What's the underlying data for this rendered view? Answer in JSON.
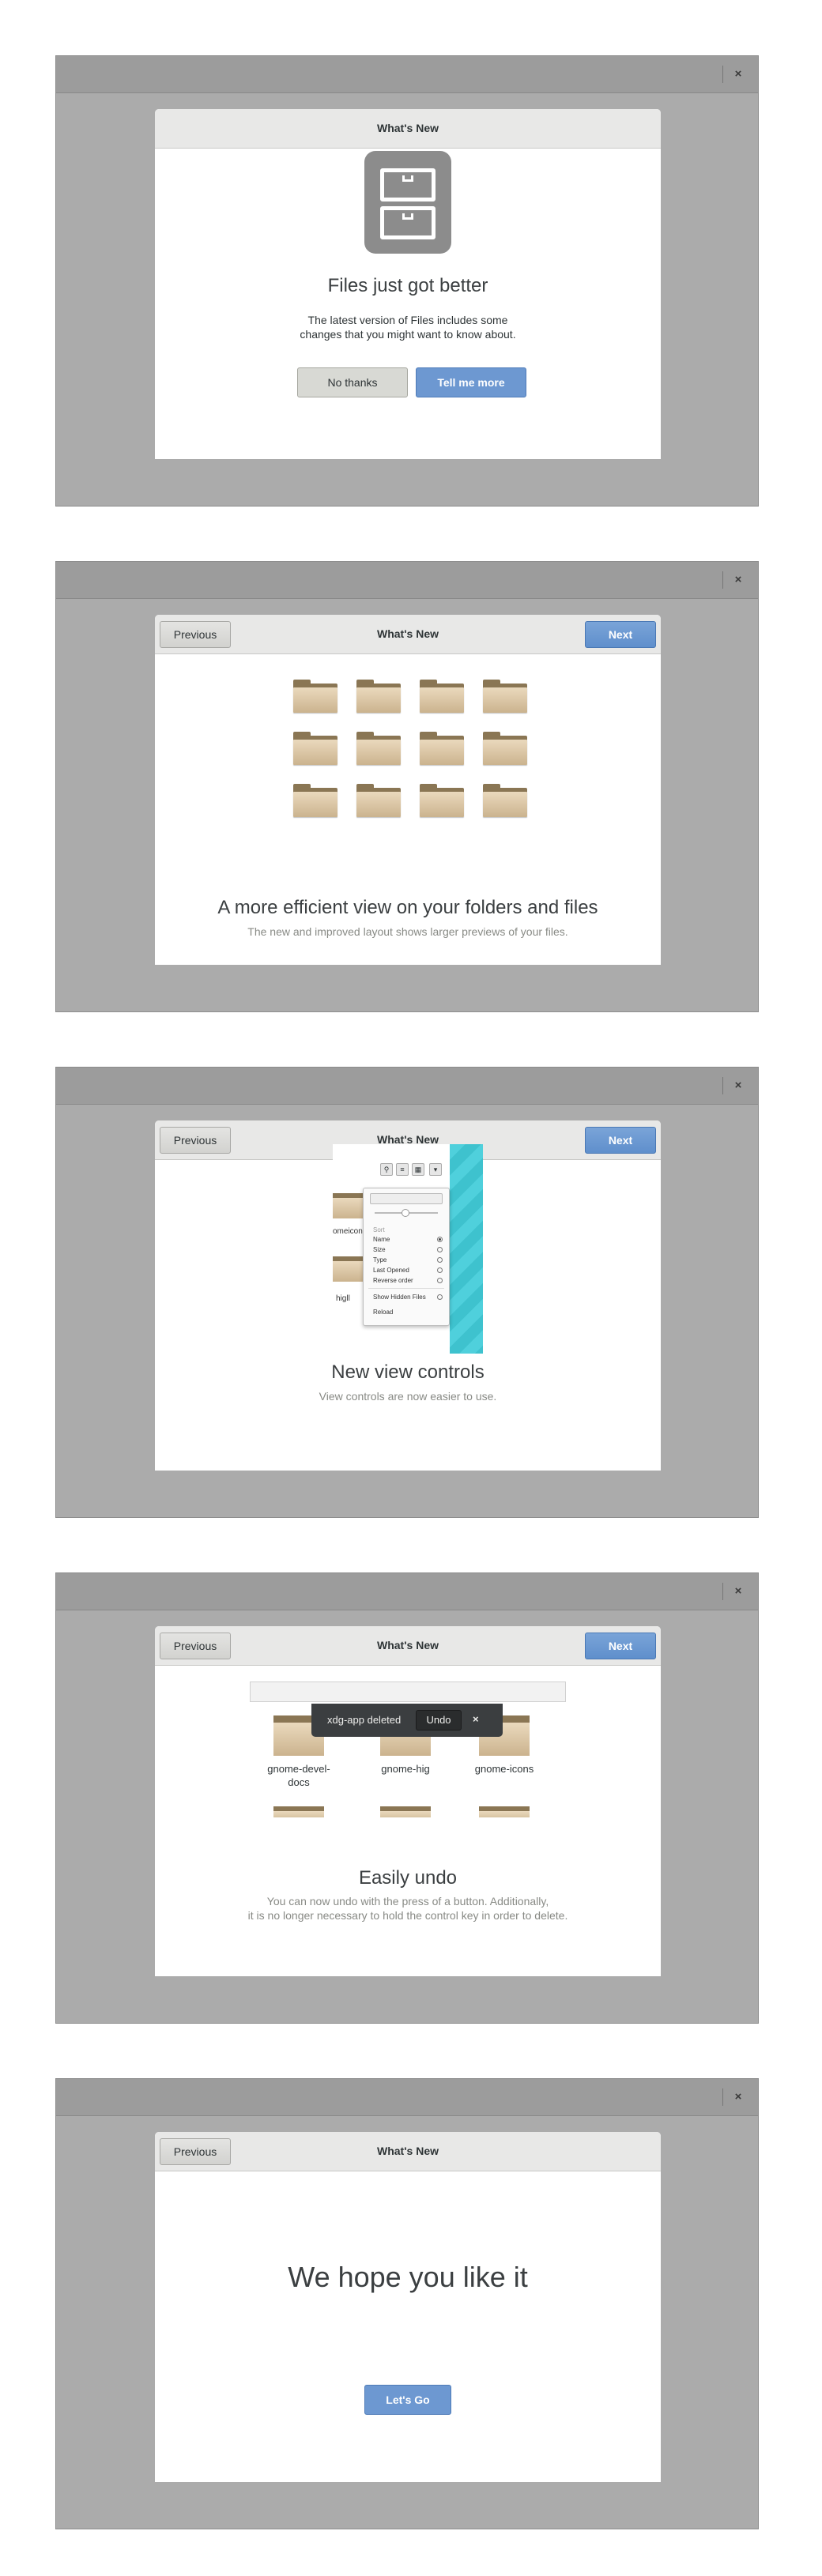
{
  "window": {
    "close_glyph": "×"
  },
  "dialog": {
    "title": "What's New",
    "previous_label": "Previous",
    "next_label": "Next"
  },
  "slide1": {
    "icon": "file-cabinet-icon",
    "heading": "Files just got better",
    "desc_line1": "The latest version of Files includes some",
    "desc_line2": "changes that you might want to know about.",
    "no_thanks_label": "No thanks",
    "tell_me_more_label": "Tell me more"
  },
  "slide2": {
    "icon": "folder-icon",
    "heading": "A more efficient view on your folders and files",
    "sub": "The new and improved layout shows larger previews of your files."
  },
  "slide3": {
    "heading": "New view controls",
    "sub": "View controls are now easier to use.",
    "illustration": {
      "folder_labels": [
        "omeicons",
        "higll"
      ],
      "menu_section": "Sort",
      "menu_items": [
        "Name",
        "Size",
        "Type",
        "Last Opened",
        "Reverse order"
      ],
      "show_hidden_label": "Show Hidden Files",
      "reload_label": "Reload"
    }
  },
  "slide4": {
    "heading": "Easily undo",
    "sub_line1": "You can now undo with the press of a button. Additionally,",
    "sub_line2": "it is no longer necessary to hold the control key in order to delete.",
    "toast_text": "xdg-app deleted",
    "undo_label": "Undo",
    "toast_close": "×",
    "folders": [
      {
        "label_line1": "gnome-devel-",
        "label_line2": "docs"
      },
      {
        "label_line1": "gnome-hig",
        "label_line2": ""
      },
      {
        "label_line1": "gnome-icons",
        "label_line2": ""
      }
    ]
  },
  "slide5": {
    "heading": "We hope you like it",
    "lets_go_label": "Let's Go"
  }
}
